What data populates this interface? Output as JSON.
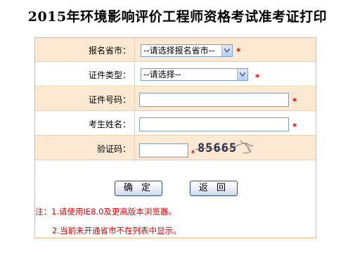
{
  "page": {
    "title": "2015年环境影响评价工程师资格考试准考证打印"
  },
  "form": {
    "province": {
      "label": "报名省市：",
      "selected": "--请选择报名省市--",
      "required": "*"
    },
    "id_type": {
      "label": "证件类型：",
      "selected": "--请选择--",
      "required": "*"
    },
    "id_number": {
      "label": "证件号码：",
      "value": "",
      "required": "*"
    },
    "name": {
      "label": "考生姓名：",
      "value": "",
      "required": "*"
    },
    "captcha": {
      "label": "验证码：",
      "value": "",
      "required": "*",
      "image_text": "85665"
    }
  },
  "buttons": {
    "confirm": "确 定",
    "back": "返 回"
  },
  "notes": {
    "line1": "注：1.请使用IE8.0及更高版本浏览器。",
    "line2": "2.当前未开通省市不在列表中显示。"
  },
  "colors": {
    "row_shade": "#fde8d2",
    "border": "#e8b48a",
    "required": "#e00000"
  }
}
